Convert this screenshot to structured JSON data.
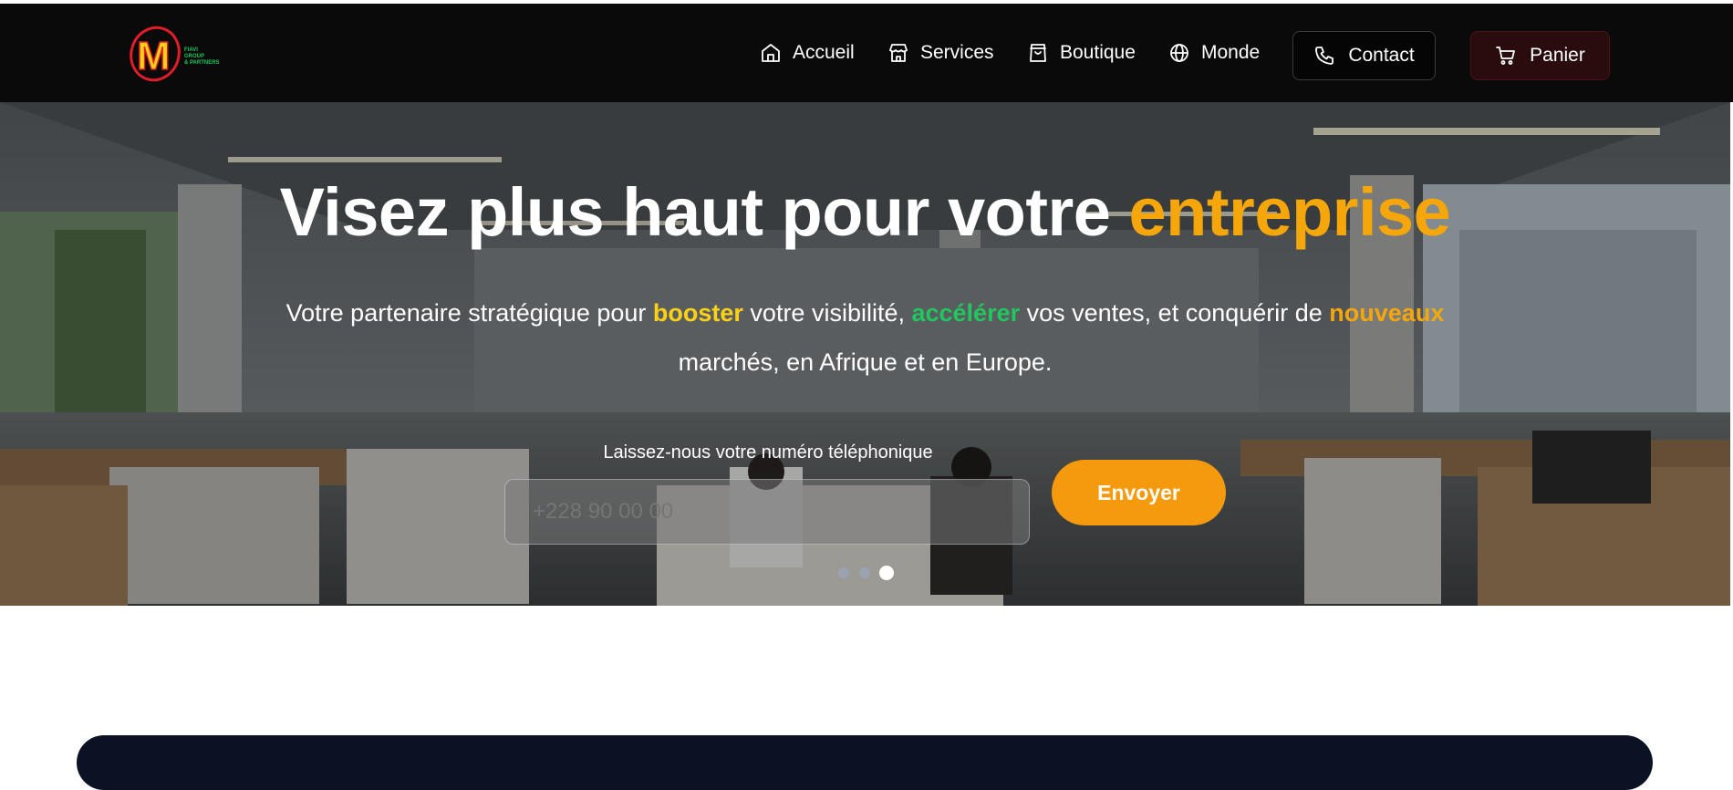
{
  "header": {
    "logo_letter": "M",
    "logo_text_lines": [
      "FIAVI",
      "GROUP",
      "& PARTNERS"
    ],
    "nav": [
      {
        "label": "Accueil",
        "icon": "home-icon"
      },
      {
        "label": "Services",
        "icon": "store-icon"
      },
      {
        "label": "Boutique",
        "icon": "bag-icon"
      },
      {
        "label": "Monde",
        "icon": "globe-icon"
      }
    ],
    "contact_label": "Contact",
    "panier_label": "Panier"
  },
  "hero": {
    "title_main": "Visez plus haut pour votre ",
    "title_accent": "entreprise",
    "subtitle_parts": [
      "Votre partenaire stratégique pour ",
      "booster",
      " votre visibilité, ",
      "accélérer",
      " vos ventes, et conquérir de ",
      "nouveaux",
      " marchés, en Afrique et en Europe."
    ],
    "phone_label": "Laissez-nous votre numéro téléphonique",
    "phone_placeholder": "+228 90 00 00",
    "send_label": "Envoyer",
    "background_watermark": "1600 × 200",
    "slides_count": 3,
    "active_slide": 3
  },
  "colors": {
    "accent_orange": "#f5a60a",
    "accent_yellow": "#fcd116",
    "accent_green": "#22c55e",
    "button_orange": "#f59a0c"
  }
}
